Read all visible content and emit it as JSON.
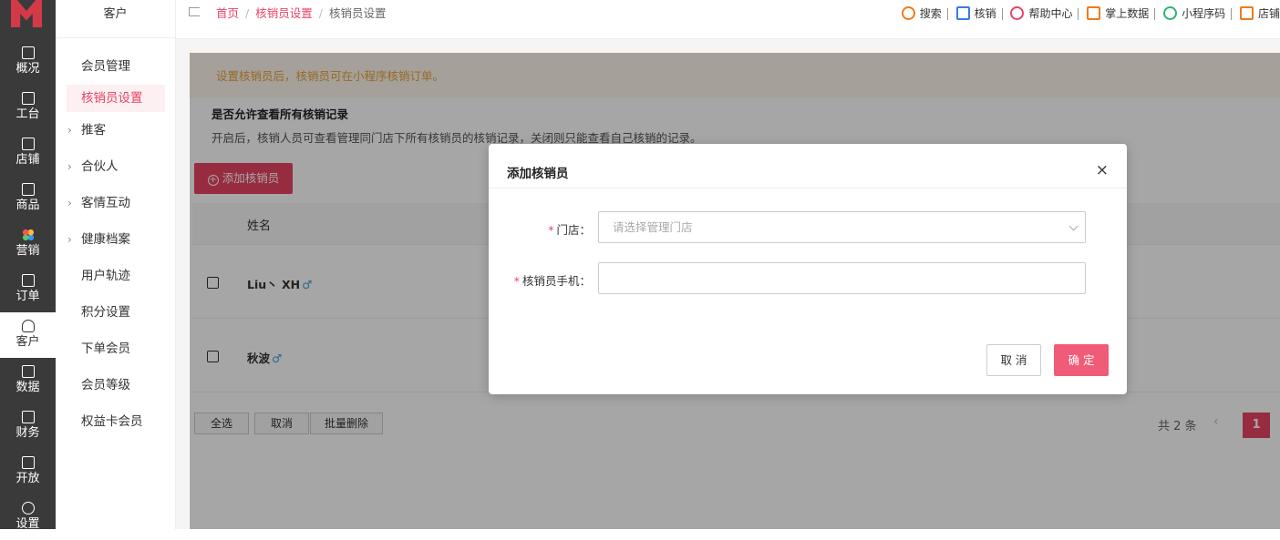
{
  "rail": {
    "items": [
      {
        "label": "概况",
        "icon": "overview-icon"
      },
      {
        "label": "工台",
        "icon": "monitor-icon"
      },
      {
        "label": "店铺",
        "icon": "store-icon"
      },
      {
        "label": "商品",
        "icon": "bag-icon"
      },
      {
        "label": "营销",
        "icon": "marketing-icon"
      },
      {
        "label": "订单",
        "icon": "order-icon"
      },
      {
        "label": "客户",
        "icon": "customer-icon"
      },
      {
        "label": "数据",
        "icon": "data-icon"
      },
      {
        "label": "财务",
        "icon": "finance-icon"
      },
      {
        "label": "开放",
        "icon": "code-icon"
      },
      {
        "label": "设置",
        "icon": "gear-icon"
      }
    ]
  },
  "subnav": {
    "title": "客户",
    "items": [
      {
        "label": "会员管理"
      },
      {
        "label": "核销员设置"
      },
      {
        "label": "推客"
      },
      {
        "label": "合伙人"
      },
      {
        "label": "客情互动"
      },
      {
        "label": "健康档案"
      },
      {
        "label": "用户轨迹"
      },
      {
        "label": "积分设置"
      },
      {
        "label": "下单会员"
      },
      {
        "label": "会员等级"
      },
      {
        "label": "权益卡会员"
      }
    ]
  },
  "breadcrumb": [
    "首页",
    "核销员设置",
    "核销员设置"
  ],
  "top_actions": [
    {
      "label": "搜索",
      "icon": "search-icon",
      "color": "#f07b1a"
    },
    {
      "label": "核销",
      "icon": "scan-icon",
      "color": "#3a7be0"
    },
    {
      "label": "帮助中心",
      "icon": "help-icon",
      "color": "#e84464"
    },
    {
      "label": "掌上数据",
      "icon": "chart-icon",
      "color": "#f07b1a"
    },
    {
      "label": "小程序码",
      "icon": "miniprogram-icon",
      "color": "#2bb673"
    },
    {
      "label": "店铺",
      "icon": "shop-icon",
      "color": "#f07b1a"
    }
  ],
  "content": {
    "notice": "设置核销员后，核销员可在小程序核销订单。",
    "option_title": "是否允许查看所有核销记录",
    "option_desc": "开启后，核销人员可查看管理同门店下所有核销员的核销记录，关闭则只能查看自己核销的记录。",
    "add_button": "添加核销员",
    "table": {
      "header_name": "姓名",
      "rows": [
        {
          "name": "Liu丶 XH",
          "gender": "♂"
        },
        {
          "name": "秋波",
          "gender": "♂"
        }
      ]
    },
    "footer": {
      "select_all": "全选",
      "cancel": "取消",
      "bulk_delete": "批量删除",
      "total": "共 2 条",
      "prev": "‹",
      "current_page": "1"
    }
  },
  "dialog": {
    "title": "添加核销员",
    "close": "×",
    "store_label": "门店：",
    "store_placeholder": "请选择管理门店",
    "phone_label": "核销员手机：",
    "phone_value": "",
    "required_mark": "*",
    "cancel_label": "取 消",
    "ok_label": "确 定"
  }
}
